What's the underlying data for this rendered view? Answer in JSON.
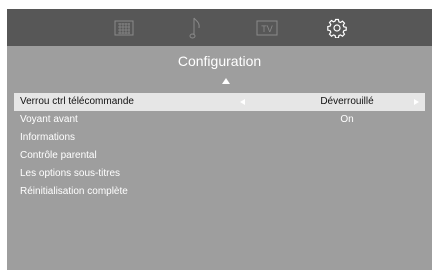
{
  "tabs": [
    {
      "icon": "picture-grid-icon",
      "active": false
    },
    {
      "icon": "music-note-icon",
      "active": false
    },
    {
      "icon": "tv-icon",
      "active": false
    },
    {
      "icon": "settings-gear-icon",
      "active": true
    }
  ],
  "tv_label": "TV",
  "title": "Configuration",
  "menu": [
    {
      "label": "Verrou ctrl télécommande",
      "value": "Déverrouillé",
      "selected": true
    },
    {
      "label": "Voyant avant",
      "value": "On",
      "selected": false
    },
    {
      "label": "Informations",
      "value": "",
      "selected": false
    },
    {
      "label": "Contrôle parental",
      "value": "",
      "selected": false
    },
    {
      "label": "Les options sous-titres",
      "value": "",
      "selected": false
    },
    {
      "label": "Réinitialisation complète",
      "value": "",
      "selected": false
    }
  ],
  "colors": {
    "top_bar": "#575757",
    "background": "#9e9e9e",
    "selected_row": "#e6e6e6",
    "icon_inactive": "#8a8a8a",
    "icon_active": "#ffffff"
  }
}
